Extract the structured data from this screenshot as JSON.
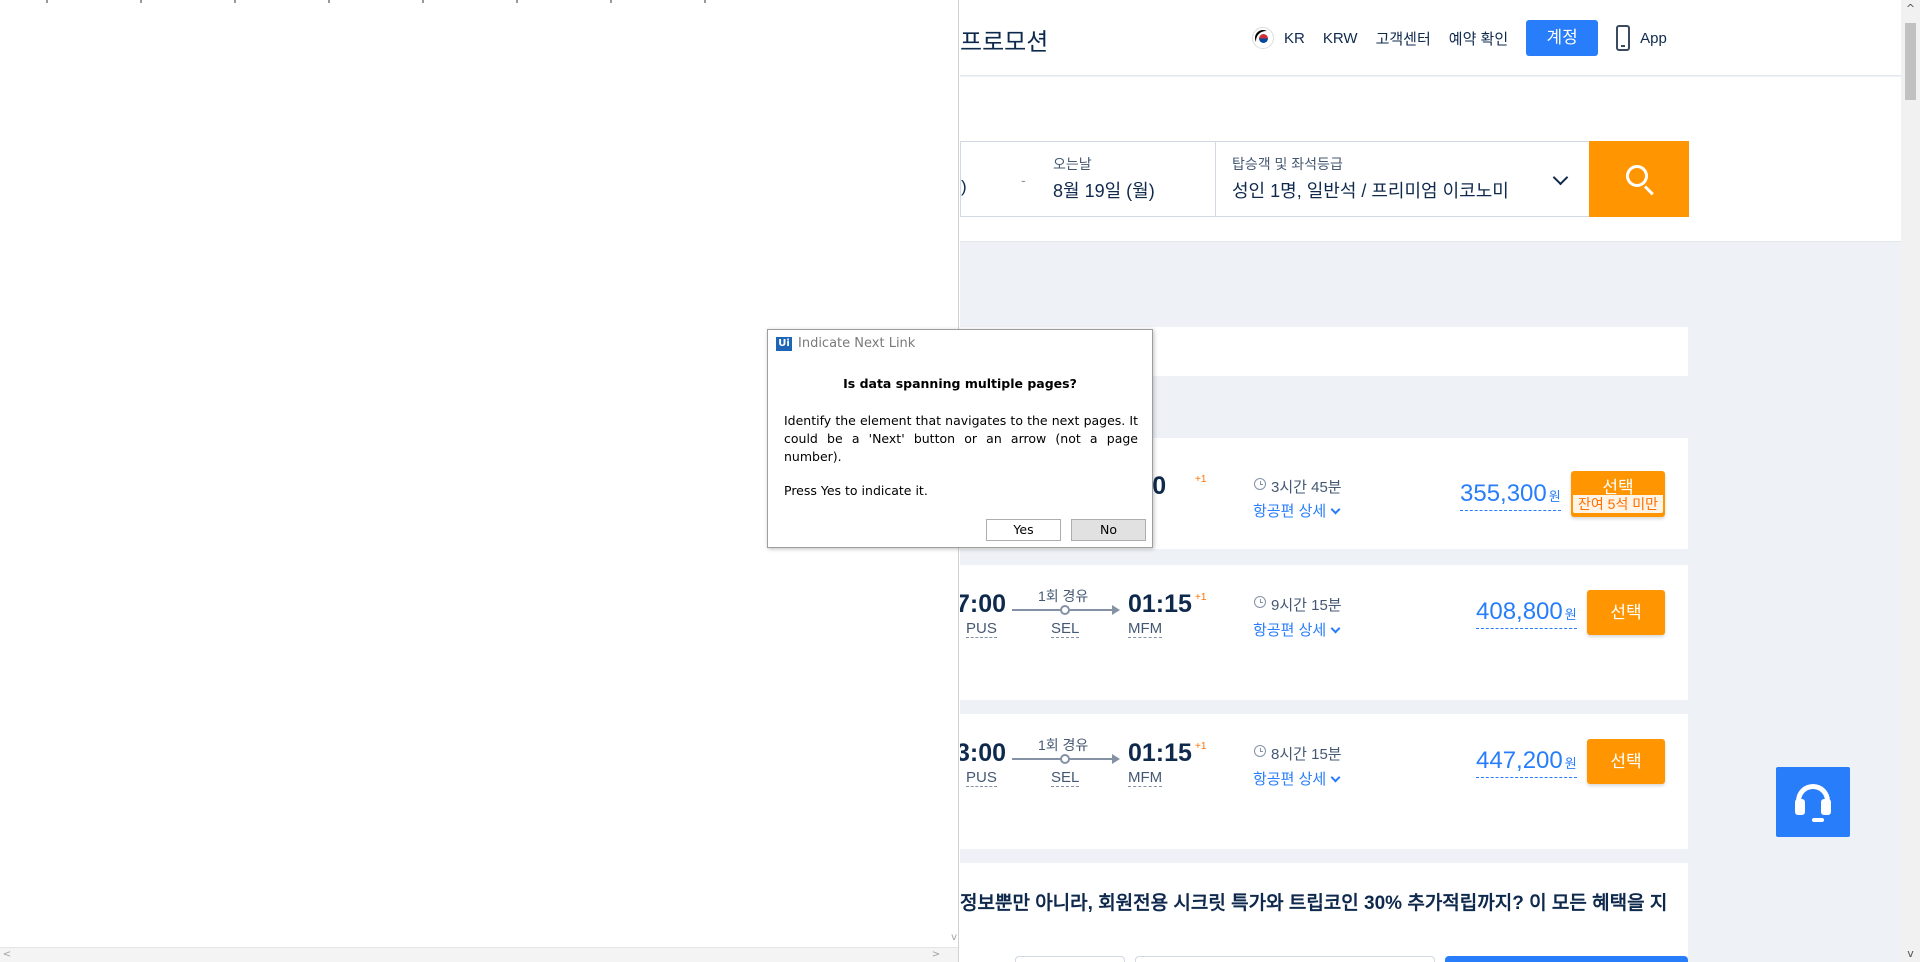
{
  "header": {
    "promo_fragment": "프로모션",
    "region": "KR",
    "currency": "KRW",
    "customer_center": "고객센터",
    "booking_check": "예약 확인",
    "account": "계정",
    "app": "App"
  },
  "search": {
    "depart_fragment": ")",
    "separator": "-",
    "return_label": "오는날",
    "return_value": "8월 19일 (월)",
    "passenger_label": "탑승객 및 좌석등급",
    "passenger_value": "성인 1명, 일반석 / 프리미엄 이코노미",
    "icon": "search-icon"
  },
  "flights": [
    {
      "depart_time": "",
      "depart_code": "",
      "arrive_time": ":50",
      "arrive_code": "M",
      "plus_day": "+1",
      "stops": "",
      "via": "",
      "duration": "3시간 45분",
      "details": "항공편 상세",
      "price": "355,300",
      "currency_unit": "원",
      "select": "선택",
      "seats_left": "잔여 5석 미만"
    },
    {
      "depart_time": "7:00",
      "depart_code": "PUS",
      "arrive_time": "01:15",
      "arrive_code": "MFM",
      "plus_day": "+1",
      "stops": "1회 경유",
      "via": "SEL",
      "duration": "9시간 15분",
      "details": "항공편 상세",
      "price": "408,800",
      "currency_unit": "원",
      "select": "선택"
    },
    {
      "depart_time": "3:00",
      "depart_code": "PUS",
      "arrive_time": "01:15",
      "arrive_code": "MFM",
      "plus_day": "+1",
      "stops": "1회 경유",
      "via": "SEL",
      "duration": "8시간 15분",
      "details": "항공편 상세",
      "price": "447,200",
      "currency_unit": "원",
      "select": "선택"
    }
  ],
  "member_banner": {
    "text": "정보뿐만 아니라, 회원전용 시크릿 특가와 트립코인 30% 추가적립까지? 이 모든 혜택을 지"
  },
  "dialog": {
    "logo": "Ui",
    "title": "Indicate Next Link",
    "heading": "Is data spanning multiple pages?",
    "body": "Identify the element that navigates to the next pages. It could be a 'Next' button or an arrow (not a page number).",
    "prompt": "Press Yes to indicate it.",
    "yes": "Yes",
    "no": "No"
  },
  "scroll_arrows": {
    "left": "<",
    "right": ">",
    "up": "^",
    "down": "v"
  },
  "colors": {
    "accent_blue": "#287dfa",
    "accent_orange": "#ff9500",
    "text_dark": "#0f294d"
  }
}
